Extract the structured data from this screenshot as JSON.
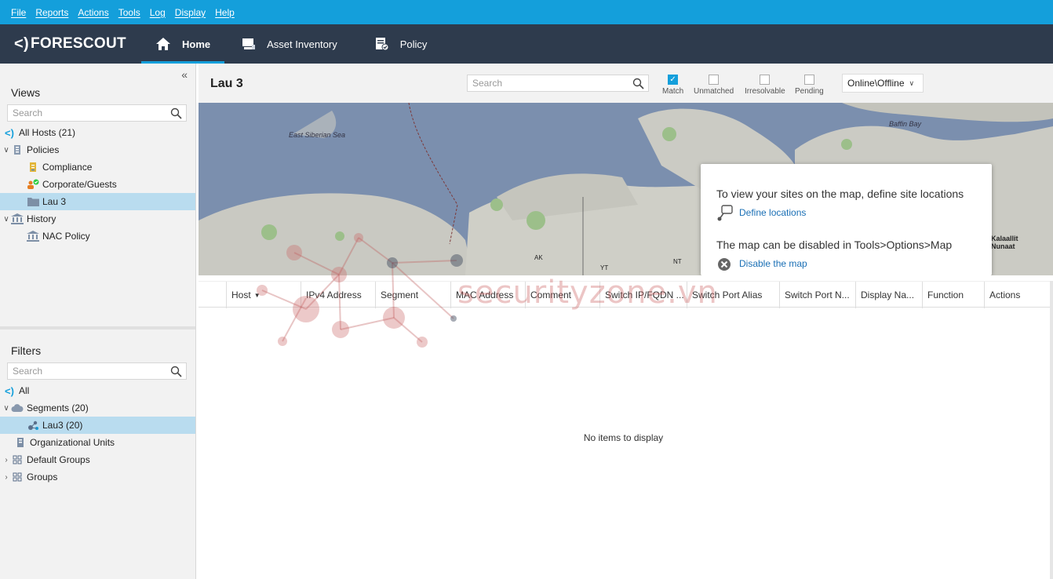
{
  "menu": [
    "File",
    "Reports",
    "Actions",
    "Tools",
    "Log",
    "Display",
    "Help"
  ],
  "brand": "FORESCOUT",
  "nav": {
    "home": "Home",
    "asset_inventory": "Asset Inventory",
    "policy": "Policy"
  },
  "views": {
    "title": "Views",
    "search_placeholder": "Search",
    "items": [
      {
        "label": "All Hosts (21)"
      },
      {
        "label": "Policies"
      },
      {
        "label": "Compliance"
      },
      {
        "label": "Corporate/Guests"
      },
      {
        "label": "Lau 3"
      },
      {
        "label": "History"
      },
      {
        "label": "NAC Policy"
      }
    ]
  },
  "filters": {
    "title": "Filters",
    "search_placeholder": "Search",
    "items": [
      {
        "label": "All"
      },
      {
        "label": "Segments (20)"
      },
      {
        "label": "Lau3 (20)"
      },
      {
        "label": "Organizational Units"
      },
      {
        "label": "Default Groups"
      },
      {
        "label": "Groups"
      }
    ]
  },
  "main": {
    "title": "Lau 3",
    "search_placeholder": "Search",
    "checkboxes": [
      {
        "label": "Match",
        "checked": true
      },
      {
        "label": "Unmatched",
        "checked": false
      },
      {
        "label": "Irresolvable",
        "checked": false
      },
      {
        "label": "Pending",
        "checked": false
      }
    ],
    "dropdown": "Online\\Offline"
  },
  "map": {
    "labels": [
      "East Siberian Sea",
      "Baffin Bay",
      "AK",
      "YT",
      "NT",
      "Kalaallit Nunaat"
    ],
    "popover": {
      "msg1": "To view your sites on the map, define site locations",
      "link1": "Define locations",
      "msg2": "The map can be disabled in Tools>Options>Map",
      "link2": "Disable the map"
    }
  },
  "table": {
    "columns": [
      "Host",
      "IPv4 Address",
      "Segment",
      "MAC Address",
      "Comment",
      "Switch IP/FQDN ...",
      "Switch Port Alias",
      "Switch Port N...",
      "Display Na...",
      "Function",
      "Actions"
    ],
    "empty": "No items to display"
  },
  "watermark": "securityzone.vn"
}
